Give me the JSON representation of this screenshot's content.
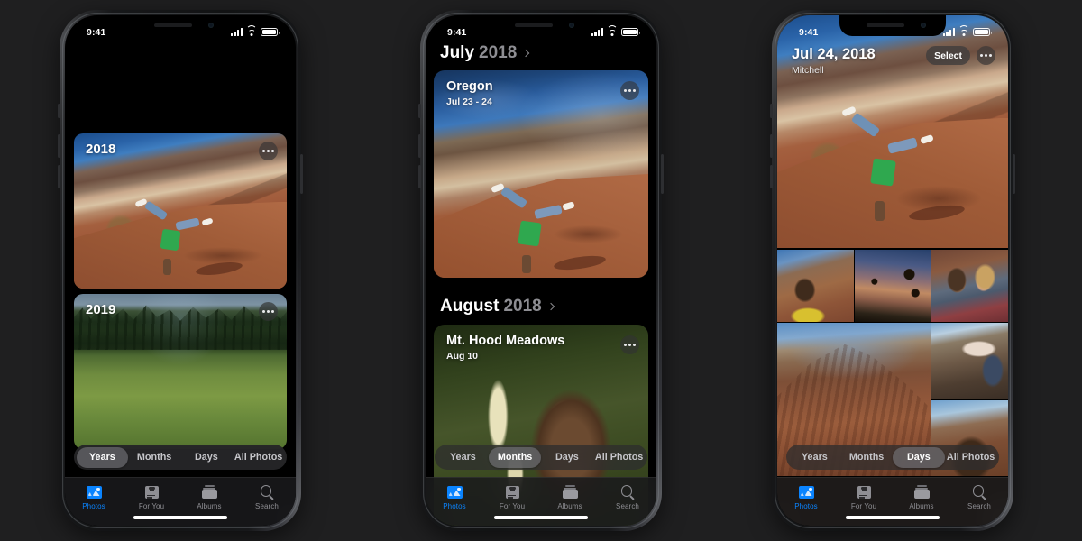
{
  "app": {
    "name": "Photos",
    "accent": "#0a84ff",
    "background": "#1f1f20"
  },
  "status_bar": {
    "time": "9:41",
    "signal": "cellular-bars-icon",
    "wifi": "wifi-icon",
    "battery": "battery-icon"
  },
  "tab_bar": {
    "items": [
      {
        "label": "Photos",
        "icon": "photos-icon",
        "active": true
      },
      {
        "label": "For You",
        "icon": "for-you-icon",
        "active": false
      },
      {
        "label": "Albums",
        "icon": "albums-icon",
        "active": false
      },
      {
        "label": "Search",
        "icon": "search-icon",
        "active": false
      }
    ]
  },
  "segmented_control": {
    "options": [
      "Years",
      "Months",
      "Days",
      "All Photos"
    ]
  },
  "phone_years": {
    "selected_segment": "Years",
    "top_photo": "lake-forest-photo",
    "cards": [
      {
        "label": "2018",
        "photo": "painted-hills-cartwheel-photo",
        "menu": "more-options-icon"
      },
      {
        "label": "2019",
        "photo": "green-meadow-pines-photo",
        "menu": "more-options-icon"
      }
    ]
  },
  "phone_months": {
    "selected_segment": "Months",
    "sections": [
      {
        "month": "July",
        "year": "2018",
        "chevron": "chevron-right-icon",
        "card": {
          "title": "Oregon",
          "subtitle": "Jul 23 - 24",
          "photo": "oregon-painted-hills-photo",
          "menu": "more-options-icon"
        }
      },
      {
        "month": "August",
        "year": "2018",
        "chevron": "chevron-right-icon",
        "card": {
          "title": "Mt. Hood Meadows",
          "subtitle": "Aug 10",
          "photo": "portrait-beargrass-photo",
          "menu": "more-options-icon"
        }
      }
    ]
  },
  "phone_days": {
    "selected_segment": "Days",
    "header": {
      "title": "Jul 24, 2018",
      "subtitle": "Mitchell",
      "select_label": "Select",
      "menu": "more-options-icon"
    },
    "hero_photo": "painted-hills-cartwheel-photo",
    "grid": [
      {
        "photo": "boy-on-hillside-photo"
      },
      {
        "photo": "sunflower-dusk-silhouette-photo"
      },
      {
        "photo": "couple-selfie-photo"
      },
      {
        "photo": "red-mountain-photo"
      },
      {
        "photo": "shoe-on-rock-photo"
      },
      {
        "photo": "curly-hair-hillside-photo"
      }
    ]
  }
}
